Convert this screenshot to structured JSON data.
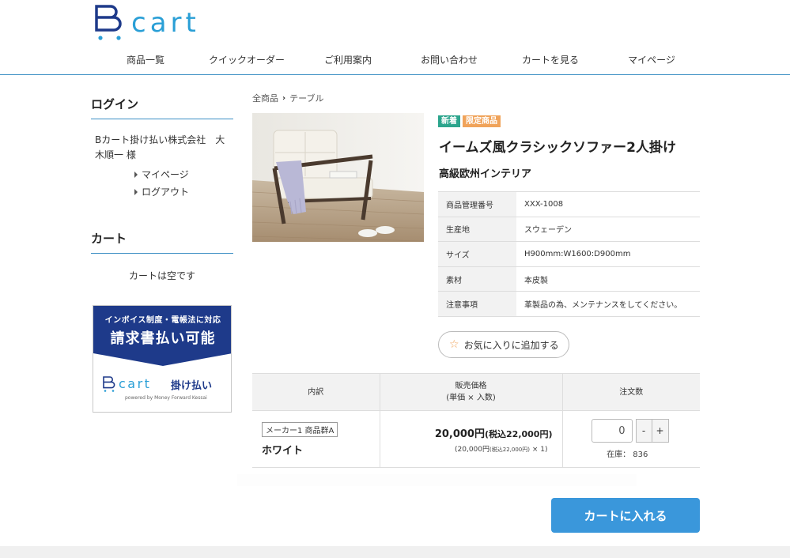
{
  "header": {
    "logo_text": "cart",
    "nav": [
      "商品一覧",
      "クイックオーダー",
      "ご利用案内",
      "お問い合わせ",
      "カートを見る",
      "マイページ"
    ]
  },
  "sidebar": {
    "login_title": "ログイン",
    "user_name": "Bカート掛け払い株式会社　大木順一 様",
    "links": [
      "マイページ",
      "ログアウト"
    ],
    "cart_title": "カート",
    "cart_empty": "カートは空です",
    "banner": {
      "line1": "インボイス制度・電帳法に対応",
      "line2": "請求書払い可能",
      "logo_text": "cart",
      "kakebarai": "掛け払い",
      "powered": "powered by Money Forward Kessai"
    }
  },
  "breadcrumb": [
    "全商品",
    "テーブル"
  ],
  "product": {
    "badges": [
      "新着",
      "限定商品"
    ],
    "title": "イームズ風クラシックソファー2人掛け",
    "maker": "高級欧州インテリア",
    "specs": [
      {
        "key": "商品管理番号",
        "value": "XXX-1008"
      },
      {
        "key": "生産地",
        "value": "スウェーデン"
      },
      {
        "key": "サイズ",
        "value": "H900mm:W1600:D900mm"
      },
      {
        "key": "素材",
        "value": "本皮製"
      },
      {
        "key": "注意事項",
        "value": "革製品の為、メンテナンスをしてください。"
      }
    ],
    "favorite_label": "お気に入りに追加する"
  },
  "order_table": {
    "headers": [
      "内訳",
      "販売価格",
      "(単価 × 入数)",
      "注文数"
    ],
    "row": {
      "variant_tag": "メーカー1 商品群A",
      "variant_name": "ホワイト",
      "price": "20,000円",
      "price_tax": "(税込22,000円)",
      "unit_price": "(20,000円",
      "unit_tax": "(税込22,000円)",
      "unit_qty": "× 1)",
      "qty_value": "0",
      "minus": "-",
      "plus": "+",
      "stock": "在庫： 836"
    }
  },
  "add_to_cart": "カートに入れる",
  "colors": {
    "accent": "#3a97db",
    "header_line": "#3b8fc4",
    "badge_new": "#2ca58d",
    "badge_limited": "#f0a35a",
    "banner_navy": "#1e3a8a"
  }
}
